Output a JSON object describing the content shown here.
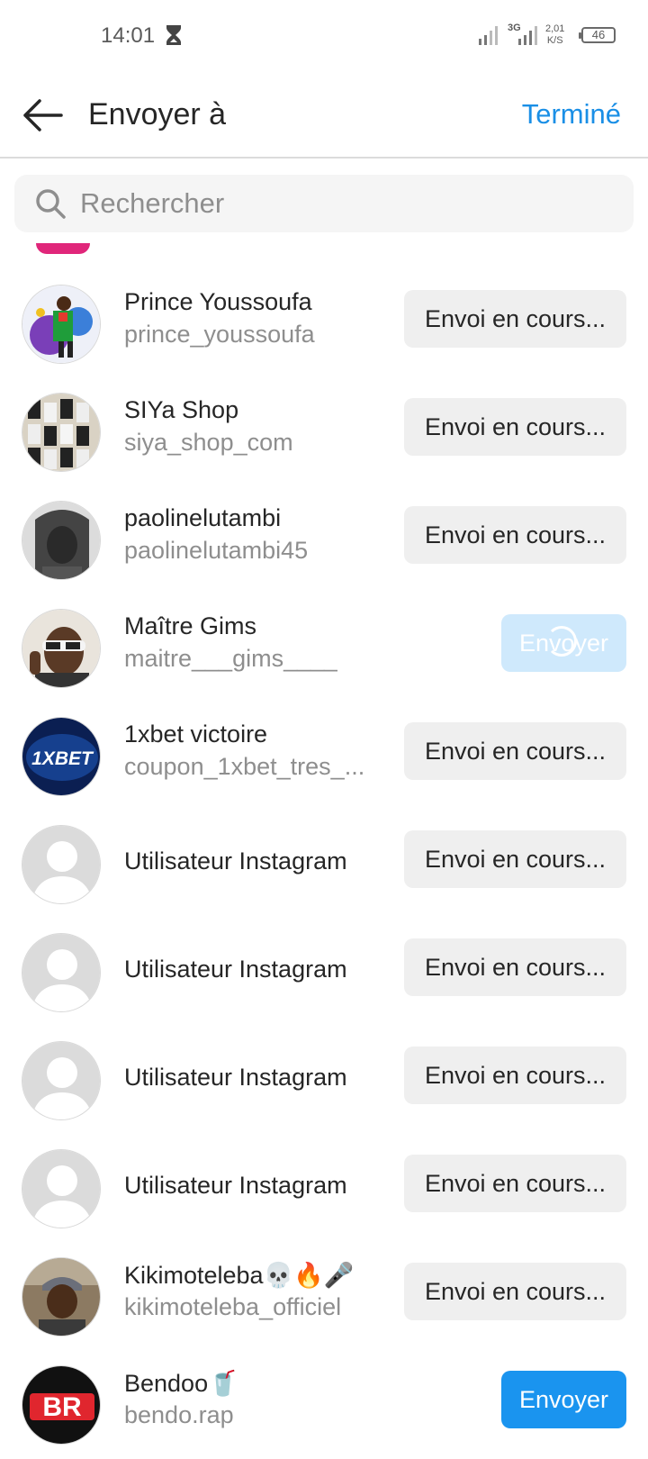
{
  "status_bar": {
    "time": "14:01",
    "network": "3G",
    "speed_value": "2,01",
    "speed_unit": "K/S",
    "battery": "46"
  },
  "header": {
    "title": "Envoyer à",
    "done_label": "Terminé"
  },
  "search": {
    "placeholder": "Rechercher"
  },
  "contacts": [
    {
      "name": "Prince Youssoufa",
      "handle": "prince_youssoufa",
      "action": "Envoi en cours..."
    },
    {
      "name": "SIYa Shop",
      "handle": "siya_shop_com",
      "action": "Envoi en cours..."
    },
    {
      "name": "paolinelutambi",
      "handle": "paolinelutambi45",
      "action": "Envoi en cours..."
    },
    {
      "name": "Maître Gims",
      "handle": "maitre___gims____",
      "action": "Envoyer"
    },
    {
      "name": "1xbet victoire",
      "handle": "coupon_1xbet_tres_...",
      "action": "Envoi en cours..."
    },
    {
      "name": "Utilisateur Instagram",
      "handle": "",
      "action": "Envoi en cours..."
    },
    {
      "name": "Utilisateur Instagram",
      "handle": "",
      "action": "Envoi en cours..."
    },
    {
      "name": "Utilisateur Instagram",
      "handle": "",
      "action": "Envoi en cours..."
    },
    {
      "name": "Utilisateur Instagram",
      "handle": "",
      "action": "Envoi en cours..."
    },
    {
      "name": "Kikimoteleba💀🔥🎤",
      "handle": "kikimoteleba_officiel",
      "action": "Envoi en cours..."
    },
    {
      "name": "Bendoo🥤",
      "handle": "bendo.rap",
      "action": "Envoyer"
    }
  ],
  "avatar_texts": {
    "xbet_logo": "1XBET",
    "bendo_logo": "BR"
  },
  "colors": {
    "accent": "#1a94ef",
    "pending_bg": "#efefef",
    "secondary_text": "#8e8e8e"
  }
}
